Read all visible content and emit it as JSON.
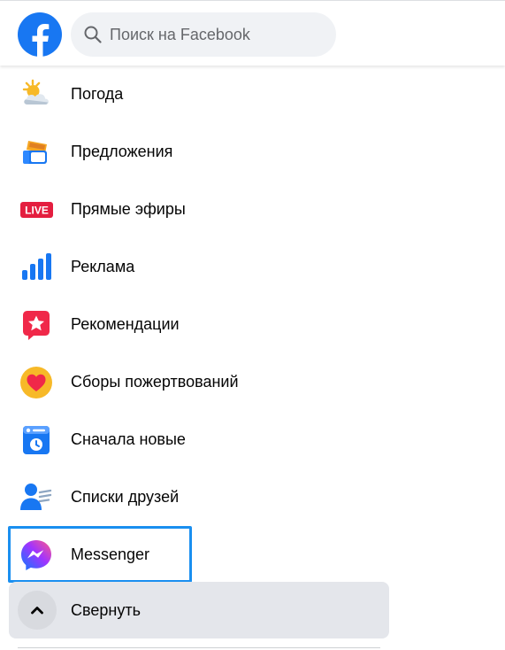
{
  "search": {
    "placeholder": "Поиск на Facebook"
  },
  "menu": {
    "items": [
      {
        "label": "Погода",
        "icon": "weather-icon"
      },
      {
        "label": "Предложения",
        "icon": "offers-icon"
      },
      {
        "label": "Прямые эфиры",
        "icon": "live-icon",
        "badge": "LIVE"
      },
      {
        "label": "Реклама",
        "icon": "ads-chart-icon"
      },
      {
        "label": "Рекомендации",
        "icon": "recommendations-star-icon"
      },
      {
        "label": "Сборы пожертвований",
        "icon": "fundraisers-heart-icon"
      },
      {
        "label": "Сначала новые",
        "icon": "most-recent-icon"
      },
      {
        "label": "Списки друзей",
        "icon": "friend-lists-icon"
      },
      {
        "label": "Messenger",
        "icon": "messenger-icon",
        "highlighted": true
      },
      {
        "label": "Свернуть",
        "icon": "chevron-up-icon"
      }
    ]
  },
  "colors": {
    "facebook_blue": "#1877f2",
    "highlight_border": "#1a8ff0",
    "search_bg": "#f0f2f5",
    "collapse_bg": "#e4e6eb",
    "live_red": "#e41e3f"
  }
}
